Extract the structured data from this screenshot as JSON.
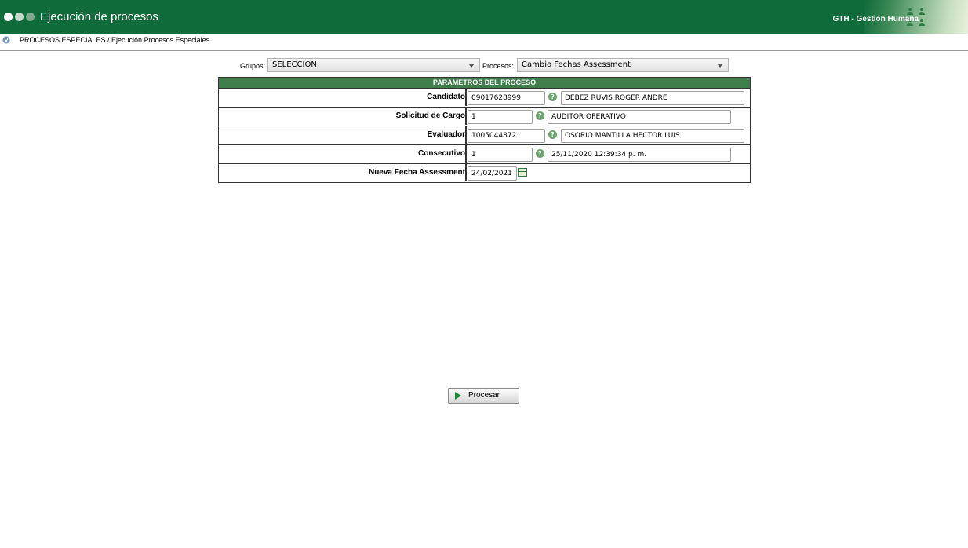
{
  "header": {
    "title": "Ejecución de procesos",
    "brand": "GTH - Gestión Humana"
  },
  "breadcrumb": {
    "text": "PROCESOS ESPECIALES / Ejecución Procesos Especiales"
  },
  "filters": {
    "grupos_label": "Grupos:",
    "grupos_value": "SELECCION",
    "procesos_label": "Procesos:",
    "procesos_value": "Cambio Fechas Assessment"
  },
  "params": {
    "header": "PARAMETROS DEL PROCESO",
    "rows": [
      {
        "label": "Candidato",
        "code": "09017628999",
        "desc": "DEBEZ RUVIS ROGER ANDRE"
      },
      {
        "label": "Solicitud de Cargo",
        "code": "1",
        "desc": "AUDITOR OPERATIVO"
      },
      {
        "label": "Evaluador",
        "code": "1005044872",
        "desc": "OSORIO MANTILLA HECTOR LUIS"
      },
      {
        "label": "Consecutivo",
        "code": "1",
        "desc": "25/11/2020 12:39:34 p. m."
      },
      {
        "label": "Nueva Fecha Assessment",
        "code": "24/02/2021"
      }
    ]
  },
  "actions": {
    "process_label": "Procesar"
  },
  "icons": {
    "help": "help-icon",
    "calendar": "calendar-icon",
    "play": "play-icon"
  },
  "colors": {
    "header_bg": "#0f6b3a",
    "table_header_bg": "#3f7f4c",
    "accent": "#1f8a3b"
  }
}
